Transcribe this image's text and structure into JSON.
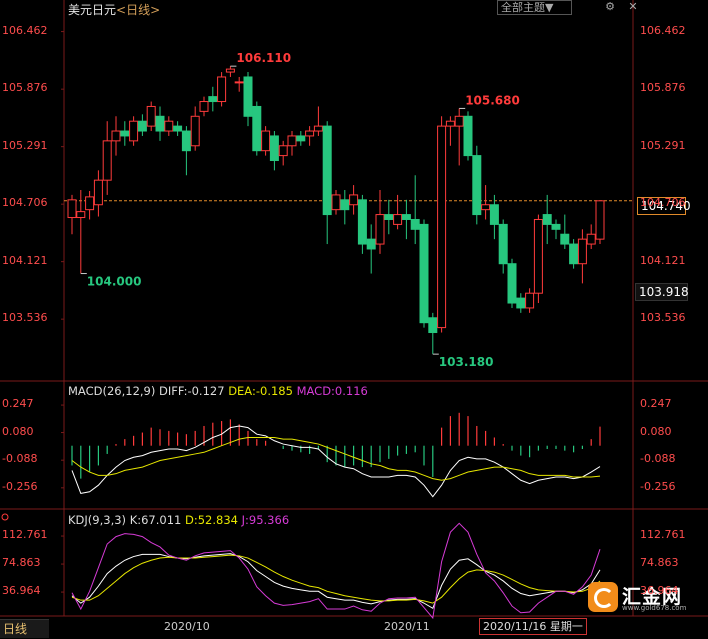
{
  "header": {
    "symbol": "美元日元",
    "timeframe": "<日线>",
    "menu_label": "全部主题▼"
  },
  "bottom_tab": "日线",
  "date_labels": [
    "2020/10",
    "2020/11"
  ],
  "cursor_date": "2020/11/16 星期一",
  "logo": {
    "brand": "汇金网",
    "url": "www.gold678.com"
  },
  "colors": {
    "up": "#ff3b3b",
    "down": "#27c77f",
    "grid": "#7a1a1a",
    "axis_text": "#ff4d4d",
    "macd_line": "#ffffff",
    "macd_dea": "#e6e600",
    "kdj_j": "#d63bd6"
  },
  "chart_data": [
    {
      "type": "candlestick",
      "title": "美元日元",
      "yticks": [
        "106.462",
        "105.876",
        "105.291",
        "104.706",
        "104.121",
        "103.536"
      ],
      "ylim": [
        103.1,
        106.6
      ],
      "last_price": "104.740",
      "cursor_price": "103.918",
      "annotations": [
        {
          "label": "106.110",
          "value": 106.11
        },
        {
          "label": "105.680",
          "value": 105.68
        },
        {
          "label": "104.000",
          "value": 104.0
        },
        {
          "label": "103.180",
          "value": 103.18
        }
      ],
      "candles": [
        [
          104.57,
          104.75,
          104.4,
          104.8
        ],
        [
          104.57,
          104.63,
          104.0,
          104.85
        ],
        [
          104.65,
          104.78,
          104.55,
          104.84
        ],
        [
          104.7,
          104.95,
          104.58,
          105.05
        ],
        [
          104.95,
          105.35,
          104.8,
          105.55
        ],
        [
          105.35,
          105.45,
          105.2,
          105.6
        ],
        [
          105.45,
          105.4,
          105.3,
          105.55
        ],
        [
          105.35,
          105.55,
          105.3,
          105.6
        ],
        [
          105.55,
          105.45,
          105.4,
          105.62
        ],
        [
          105.5,
          105.7,
          105.45,
          105.75
        ],
        [
          105.6,
          105.45,
          105.35,
          105.7
        ],
        [
          105.45,
          105.55,
          105.4,
          105.6
        ],
        [
          105.5,
          105.45,
          105.4,
          105.55
        ],
        [
          105.45,
          105.25,
          105.0,
          105.5
        ],
        [
          105.3,
          105.6,
          105.25,
          105.7
        ],
        [
          105.65,
          105.75,
          105.6,
          105.8
        ],
        [
          105.8,
          105.75,
          105.65,
          105.9
        ],
        [
          105.75,
          106.0,
          105.7,
          106.05
        ],
        [
          106.05,
          106.08,
          106.0,
          106.11
        ],
        [
          105.95,
          105.95,
          105.85,
          106.0
        ],
        [
          106.0,
          105.6,
          105.5,
          106.05
        ],
        [
          105.7,
          105.25,
          105.2,
          105.75
        ],
        [
          105.25,
          105.45,
          105.2,
          105.5
        ],
        [
          105.4,
          105.15,
          105.05,
          105.45
        ],
        [
          105.2,
          105.3,
          105.1,
          105.35
        ],
        [
          105.3,
          105.4,
          105.2,
          105.45
        ],
        [
          105.4,
          105.35,
          105.3,
          105.45
        ],
        [
          105.4,
          105.45,
          105.3,
          105.5
        ],
        [
          105.45,
          105.5,
          105.4,
          105.7
        ],
        [
          105.5,
          104.6,
          104.3,
          105.55
        ],
        [
          104.65,
          104.8,
          104.6,
          104.85
        ],
        [
          104.75,
          104.65,
          104.5,
          104.85
        ],
        [
          104.7,
          104.8,
          104.6,
          104.9
        ],
        [
          104.75,
          104.3,
          104.2,
          104.8
        ],
        [
          104.35,
          104.25,
          104.0,
          104.5
        ],
        [
          104.3,
          104.6,
          104.2,
          104.85
        ],
        [
          104.6,
          104.55,
          104.4,
          104.75
        ],
        [
          104.5,
          104.6,
          104.45,
          104.8
        ],
        [
          104.6,
          104.55,
          104.35,
          104.75
        ],
        [
          104.55,
          104.45,
          104.3,
          105.0
        ],
        [
          104.5,
          103.5,
          103.45,
          104.55
        ],
        [
          103.55,
          103.4,
          103.18,
          103.6
        ],
        [
          103.45,
          105.5,
          103.4,
          105.6
        ],
        [
          105.5,
          105.55,
          105.3,
          105.6
        ],
        [
          105.5,
          105.6,
          105.1,
          105.68
        ],
        [
          105.6,
          105.2,
          105.15,
          105.65
        ],
        [
          105.2,
          104.6,
          104.5,
          105.3
        ],
        [
          104.65,
          104.7,
          104.55,
          104.9
        ],
        [
          104.7,
          104.5,
          104.35,
          104.8
        ],
        [
          104.5,
          104.1,
          104.0,
          104.55
        ],
        [
          104.1,
          103.7,
          103.65,
          104.15
        ],
        [
          103.75,
          103.65,
          103.6,
          103.8
        ],
        [
          103.65,
          103.8,
          103.6,
          103.85
        ],
        [
          103.8,
          104.55,
          103.7,
          104.6
        ],
        [
          104.6,
          104.5,
          104.3,
          104.8
        ],
        [
          104.5,
          104.45,
          104.35,
          104.55
        ],
        [
          104.4,
          104.3,
          104.25,
          104.6
        ],
        [
          104.3,
          104.1,
          104.05,
          104.35
        ],
        [
          104.1,
          104.35,
          103.9,
          104.45
        ],
        [
          104.3,
          104.4,
          104.25,
          104.5
        ],
        [
          104.35,
          104.74,
          104.3,
          104.74
        ]
      ]
    },
    {
      "type": "macd",
      "title": "MACD(26,12,9)",
      "legend": [
        "DIFF:-0.127",
        "DEA:-0.185",
        "MACD:0.116"
      ],
      "yticks": [
        "0.247",
        "0.080",
        "-0.088",
        "-0.256"
      ],
      "ylim": [
        -0.33,
        0.29
      ],
      "hist": [
        -0.12,
        -0.2,
        -0.16,
        -0.12,
        -0.05,
        0.01,
        0.04,
        0.06,
        0.08,
        0.11,
        0.1,
        0.09,
        0.08,
        0.07,
        0.09,
        0.12,
        0.14,
        0.15,
        0.16,
        0.13,
        0.09,
        0.04,
        0.03,
        0.0,
        -0.02,
        -0.03,
        -0.04,
        -0.05,
        -0.02,
        -0.1,
        -0.12,
        -0.13,
        -0.12,
        -0.13,
        -0.13,
        -0.1,
        -0.08,
        -0.06,
        -0.05,
        -0.04,
        -0.12,
        -0.19,
        0.11,
        0.18,
        0.2,
        0.18,
        0.12,
        0.09,
        0.05,
        0.01,
        -0.03,
        -0.06,
        -0.07,
        -0.03,
        -0.02,
        -0.02,
        -0.03,
        -0.04,
        -0.02,
        0.04,
        0.116
      ],
      "diff": [
        -0.15,
        -0.29,
        -0.28,
        -0.24,
        -0.18,
        -0.13,
        -0.09,
        -0.07,
        -0.06,
        -0.04,
        -0.03,
        -0.02,
        -0.02,
        -0.03,
        -0.01,
        0.02,
        0.05,
        0.07,
        0.11,
        0.12,
        0.11,
        0.07,
        0.06,
        0.03,
        0.01,
        0.0,
        -0.01,
        -0.01,
        -0.02,
        -0.07,
        -0.11,
        -0.13,
        -0.14,
        -0.17,
        -0.19,
        -0.19,
        -0.19,
        -0.18,
        -0.18,
        -0.19,
        -0.24,
        -0.31,
        -0.24,
        -0.15,
        -0.09,
        -0.07,
        -0.08,
        -0.08,
        -0.1,
        -0.13,
        -0.17,
        -0.21,
        -0.23,
        -0.21,
        -0.2,
        -0.19,
        -0.19,
        -0.2,
        -0.19,
        -0.16,
        -0.127
      ],
      "dea": [
        -0.09,
        -0.13,
        -0.16,
        -0.18,
        -0.18,
        -0.17,
        -0.15,
        -0.14,
        -0.13,
        -0.11,
        -0.09,
        -0.08,
        -0.07,
        -0.06,
        -0.05,
        -0.04,
        -0.02,
        -0.0,
        0.02,
        0.04,
        0.05,
        0.05,
        0.05,
        0.05,
        0.04,
        0.04,
        0.03,
        0.02,
        0.01,
        -0.01,
        -0.03,
        -0.05,
        -0.07,
        -0.09,
        -0.11,
        -0.12,
        -0.14,
        -0.15,
        -0.15,
        -0.16,
        -0.18,
        -0.2,
        -0.21,
        -0.2,
        -0.18,
        -0.16,
        -0.15,
        -0.14,
        -0.13,
        -0.13,
        -0.14,
        -0.15,
        -0.17,
        -0.18,
        -0.18,
        -0.18,
        -0.18,
        -0.19,
        -0.19,
        -0.19,
        -0.185
      ]
    },
    {
      "type": "kdj",
      "title": "KDJ(9,3,3)",
      "legend": [
        "K:67.011",
        "D:52.834",
        "J:95.366"
      ],
      "yticks": [
        "112.761",
        "74.863",
        "36.964"
      ],
      "ylim": [
        10,
        125
      ],
      "k": [
        32,
        22,
        30,
        45,
        62,
        72,
        80,
        85,
        88,
        88,
        88,
        85,
        83,
        82,
        84,
        86,
        87,
        88,
        89,
        85,
        78,
        66,
        58,
        50,
        45,
        42,
        40,
        38,
        38,
        30,
        28,
        26,
        26,
        23,
        21,
        24,
        26,
        27,
        27,
        28,
        22,
        15,
        46,
        68,
        80,
        82,
        74,
        65,
        60,
        52,
        42,
        35,
        32,
        34,
        36,
        38,
        38,
        36,
        40,
        48,
        67
      ],
      "d": [
        30,
        26,
        26,
        32,
        42,
        52,
        62,
        70,
        76,
        80,
        83,
        84,
        83,
        83,
        83,
        84,
        85,
        86,
        87,
        86,
        83,
        77,
        71,
        64,
        58,
        53,
        49,
        45,
        43,
        38,
        35,
        32,
        30,
        28,
        26,
        25,
        25,
        26,
        26,
        27,
        25,
        22,
        30,
        43,
        55,
        64,
        67,
        66,
        64,
        60,
        54,
        48,
        43,
        40,
        39,
        38,
        38,
        37,
        38,
        42,
        52
      ],
      "j": [
        36,
        14,
        38,
        70,
        102,
        112,
        116,
        115,
        112,
        104,
        98,
        87,
        83,
        80,
        86,
        90,
        91,
        92,
        93,
        83,
        68,
        44,
        32,
        22,
        19,
        20,
        22,
        24,
        28,
        14,
        14,
        14,
        18,
        13,
        11,
        22,
        28,
        29,
        29,
        30,
        16,
        2,
        78,
        118,
        130,
        118,
        88,
        63,
        52,
        36,
        18,
        9,
        10,
        22,
        30,
        38,
        38,
        34,
        44,
        60,
        95
      ]
    }
  ]
}
